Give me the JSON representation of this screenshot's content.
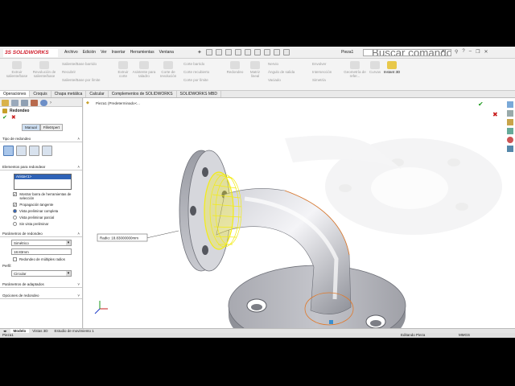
{
  "app": {
    "logo": "3S SOLIDWORKS",
    "document_name": "Pieza1"
  },
  "menus": [
    "Archivo",
    "Edición",
    "Ver",
    "Insertar",
    "Herramientas",
    "Ventana"
  ],
  "search": {
    "placeholder": "Buscar comandos"
  },
  "ribbon": {
    "extruir": "Extruir saliente/base",
    "revolucion": "Revolución de saliente/base",
    "barrido": "Saliente/Base barrido",
    "recubrir": "Recubrir",
    "barrido_limite": "Saliente/Base por límite",
    "extruir_corte": "Extruir corte",
    "asistente": "Asistente para taladro",
    "corte_revolucion": "Corte de revolución",
    "corte_barrido": "Corte barrido",
    "corte_recubierto": "Corte recubierto",
    "corte_limite": "Corte por límite",
    "redondeo": "Redondeo",
    "matriz": "Matriz lineal",
    "nervio": "Nervio",
    "angulo": "Ángulo de salida",
    "vaciado": "Vaciado",
    "envolver": "Envolver",
    "interseccion": "Intersección",
    "simetria": "Simetría",
    "geometria": "Geometría de refer...",
    "curvas": "Curvas",
    "instant3d": "Instant 3D"
  },
  "tabs": [
    "Operaciones",
    "Croquis",
    "Chapa metálica",
    "Calcular",
    "Complementos de SOLIDWORKS",
    "SOLIDWORKS MBD"
  ],
  "panel": {
    "feature_title": "Redondeo",
    "mode_tabs": [
      "Manual",
      "FilletXpert"
    ],
    "section_tipo": "Tipo de redondeo",
    "section_elementos": "Elementos para redondear",
    "selected_item": "Arista<1>",
    "chk_mostrar": "Mostrar barra de herramientas de selección",
    "chk_propagacion": "Propagación tangente",
    "rad_completa": "Vista preliminar completa",
    "rad_parcial": "Vista preliminar parcial",
    "rad_sin": "Sin vista preliminar",
    "section_parametros": "Parámetros de redondeo",
    "tipo_value": "Simétrico",
    "radio_value": "18.83mm",
    "chk_multiples": "Redondeo de múltiples radios",
    "perfil_label": "Perfil:",
    "perfil_value": "Circular",
    "section_adaptados": "Parámetros de adaptados",
    "section_opciones": "Opciones de redondeo"
  },
  "tree": {
    "root": "Pieza1 (Predeterminado<..."
  },
  "callout": {
    "text": "Radio: 18.83000000mm"
  },
  "bottom_tabs": [
    "Modelo",
    "Vistas 3D",
    "Estudio de movimiento 1"
  ],
  "status": {
    "left": "Pieza1",
    "right": "Editando Pieza",
    "units": "MMGS"
  }
}
